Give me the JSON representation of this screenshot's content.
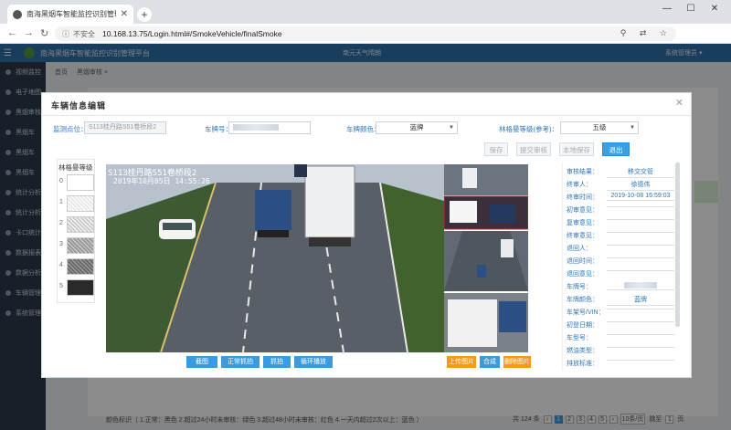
{
  "browser": {
    "tab_title": "南海黑烟车智能监控识别管理平台",
    "url_insecure_label": "不安全",
    "url": "10.168.13.75/Login.html#/SmokeVehicle/finalSmoke"
  },
  "app": {
    "title": "南海黑烟车智能监控识别管理平台",
    "weather": "南元天气晴朗",
    "user": "系统管理员 ▾",
    "breadcrumbs": [
      "首页",
      "黑烟审核 ×"
    ],
    "sidebar": [
      "视频监控",
      "电子地图",
      "黑烟审核",
      "黑烟车",
      "黑烟车",
      "黑烟车",
      "统计分析",
      "统计分析",
      "卡口统计",
      "数据报表",
      "数据分析",
      "车辆管理",
      "系统管理"
    ],
    "legend_text": "颜色标识（ 1.正常：黑色 2.超过24小时未审核：绿色 3.超过48小时未审核：红色 4.一天内超过2次以上：蓝色 ）",
    "pager": {
      "total": "共 124 条",
      "pages": [
        "1",
        "2",
        "3",
        "4",
        "5"
      ],
      "page_size": "10条/页",
      "goto_label": "跳至",
      "goto_value": "1",
      "goto_suffix": "页"
    }
  },
  "modal": {
    "title": "车辆信息编辑",
    "fields": {
      "location_label": "监测点位：",
      "location_value": "S113桂丹路S51卷桥段2",
      "plate_label": "车牌号：",
      "plate_color_label": "车牌颜色：",
      "plate_color_value": "蓝牌",
      "ringelmann_label": "林格曼等级(参考)：",
      "ringelmann_value": "五级"
    },
    "buttons": {
      "save": "保存",
      "submit_review": "提交审核",
      "local_save": "本地保存",
      "back": "退出"
    },
    "grade_panel": {
      "title": "林格曼等级",
      "levels": [
        "0",
        "1",
        "2",
        "3",
        "4",
        "5"
      ]
    },
    "photo_overlay": "S113桂丹路S51卷桥段2",
    "photo_timestamp": "2019年10月05日 14:55:26",
    "photo_buttons": [
      "截图",
      "正常抓拍",
      "抓拍",
      "循环播放"
    ],
    "action_buttons": [
      "上传图片",
      "合成",
      "删除图片"
    ],
    "info_rows": [
      {
        "label": "审核结果：",
        "value": "移交交管"
      },
      {
        "label": "终审人：",
        "value": "徐德伟"
      },
      {
        "label": "终审时间：",
        "value": "2019-10-08 16:59:03"
      },
      {
        "label": "初审意见：",
        "value": ""
      },
      {
        "label": "复审意见：",
        "value": ""
      },
      {
        "label": "终审意见：",
        "value": ""
      },
      {
        "label": "退回人：",
        "value": ""
      },
      {
        "label": "退回时间：",
        "value": ""
      },
      {
        "label": "退回意见：",
        "value": ""
      },
      {
        "label": "车牌号：",
        "value": ""
      },
      {
        "label": "车牌颜色：",
        "value": "蓝牌"
      },
      {
        "label": "车架号/VIN：",
        "value": ""
      },
      {
        "label": "初登日期：",
        "value": ""
      },
      {
        "label": "车型号：",
        "value": ""
      },
      {
        "label": "燃油类型：",
        "value": ""
      },
      {
        "label": "排放标准：",
        "value": ""
      }
    ]
  }
}
